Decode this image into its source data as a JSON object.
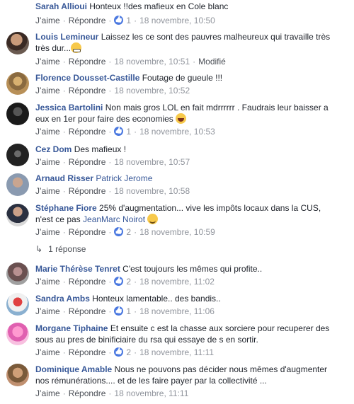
{
  "ui": {
    "like": "J’aime",
    "reply": "Répondre",
    "sep": "·"
  },
  "comments": [
    {
      "author": "Sarah Allioui",
      "text": "Honteux !!des mafieux en Cole blanc",
      "likes": "1",
      "time": "18 novembre, 10:50"
    },
    {
      "author": "Louis Lemineur",
      "text_line1": "Laissez les ce sont des pauvres malheureux qui travaille très",
      "text_line2": "très dur...",
      "time": "18 novembre, 10:51",
      "edited": "Modifié"
    },
    {
      "author": "Florence Dousset-Castille",
      "text": "Foutage de gueule !!!",
      "time": "18 novembre, 10:52"
    },
    {
      "author": "Jessica Bartolini",
      "text_line1": "Non mais gros LOL en fait mdrrrrrr . Faudrais leur baisser a",
      "text_line2": "eux en 1er pour faire des economies",
      "likes": "1",
      "time": "18 novembre, 10:53"
    },
    {
      "author": "Cez Dom",
      "text": "Des mafieux !",
      "time": "18 novembre, 10:57"
    },
    {
      "author": "Arnaud Risser",
      "mention": "Patrick Jerome",
      "time": "18 novembre, 10:58"
    },
    {
      "author": "Stéphane Fiore",
      "text_line1": "25% d'augmentation... vive les impôts locaux dans la CUS,",
      "text_line2": "n'est ce pas",
      "mention": "JeanMarc Noirot",
      "likes": "2",
      "time": "18 novembre, 10:59",
      "replies": "1 réponse"
    },
    {
      "author": "Marie Thérèse Tenret",
      "text": "C'est toujours les mêmes qui profite..",
      "likes": "2",
      "time": "18 novembre, 11:02"
    },
    {
      "author": "Sandra Ambs",
      "text": "Honteux lamentable.. des bandis..",
      "likes": "1",
      "time": "18 novembre, 11:06"
    },
    {
      "author": "Morgane Tiphaine",
      "text_line1": "Et ensuite c est la chasse aux sorciere pour recuperer des",
      "text_line2": "sous au pres de binificiaire du rsa qui essaye de s en sortir.",
      "likes": "2",
      "time": "18 novembre, 11:11"
    },
    {
      "author": "Dominique Amable",
      "text_line1": "Nous ne pouvons pas décider nous mêmes d'augmenter",
      "text_line2": "nos rémunérations.... et de les faire payer par la collectivité ...",
      "time": "18 novembre, 11:11"
    }
  ]
}
